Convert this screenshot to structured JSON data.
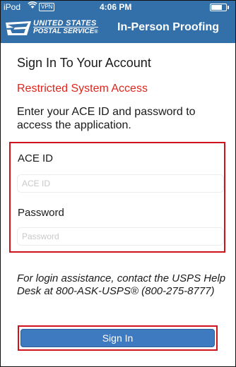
{
  "status_bar": {
    "carrier": "iPod",
    "vpn_label": "VPN",
    "time": "4:06 PM",
    "battery_level": 0.85
  },
  "header": {
    "logo_line1": "UNITED STATES",
    "logo_line2": "POSTAL SERVICE",
    "logo_reg": "®",
    "title": "In-Person Proofing",
    "background_color": "#336fa9"
  },
  "signin": {
    "heading": "Sign In To Your Account",
    "restricted_notice": "Restricted System Access",
    "instructions": "Enter your ACE ID and password to access the application.",
    "ace_id_label": "ACE ID",
    "ace_id_placeholder": "ACE ID",
    "ace_id_value": "",
    "password_label": "Password",
    "password_placeholder": "Password",
    "password_value": "",
    "help_text": "For login assistance, contact the USPS Help Desk at 800-ASK-USPS® (800-275-8777)",
    "button_label": "Sign In"
  },
  "colors": {
    "accent": "#336fa9",
    "alert": "#e0241b",
    "highlight_border": "#d0121d",
    "button": "#3e7ac0"
  },
  "icons": [
    "wifi-icon",
    "battery-icon",
    "usps-eagle-icon"
  ]
}
